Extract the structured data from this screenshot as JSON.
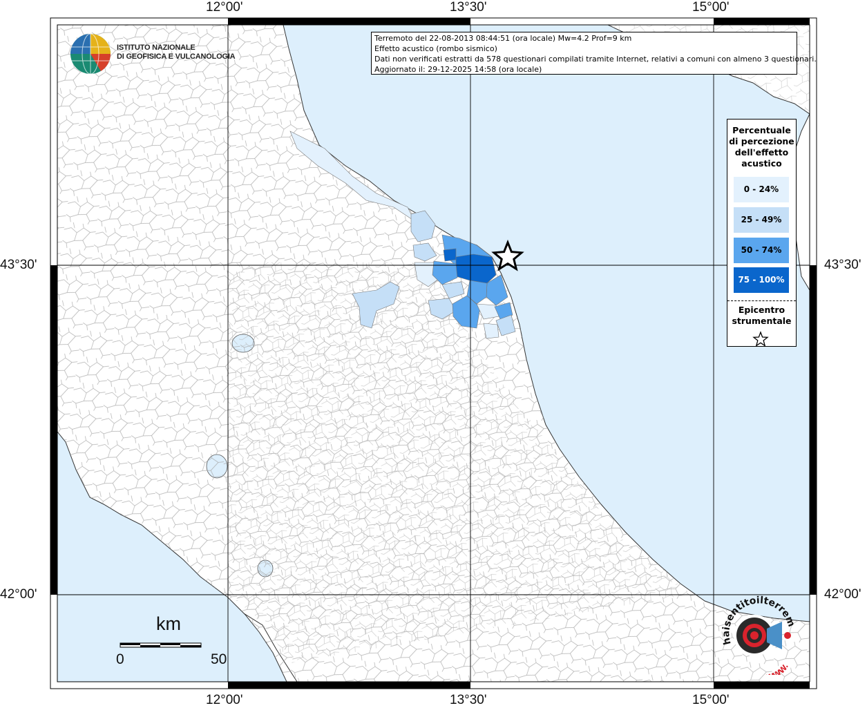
{
  "header": {
    "line1": "Terremoto del 22-08-2013 08:44:51 (ora locale) Mw=4.2 Prof=9 km",
    "line2": "Effetto acustico (rombo sismico)",
    "line3": "Dati non verificati estratti da 578 questionari compilati tramite Internet, relativi a comuni con almeno 3 questionari.",
    "line4": "Aggiornato il: 29-12-2025 14:58 (ora locale)"
  },
  "axes": {
    "top": [
      "12°00'",
      "13°30'",
      "15°00'"
    ],
    "bottom": [
      "12°00'",
      "13°30'",
      "15°00'"
    ],
    "left": [
      "43°30'",
      "42°00'"
    ],
    "right": [
      "43°30'",
      "42°00'"
    ]
  },
  "logo": {
    "line1": "ISTITUTO NAZIONALE",
    "line2": "DI GEOFISICA E VULCANOLOGIA"
  },
  "legend": {
    "title": [
      "Percentuale",
      "di percezione",
      "dell'effetto",
      "acustico"
    ],
    "items": [
      {
        "label": "0 - 24%",
        "color": "#e3f1fd"
      },
      {
        "label": "25 - 49%",
        "color": "#c5dff7"
      },
      {
        "label": "50 - 74%",
        "color": "#5aa6ee"
      },
      {
        "label": "75 - 100%",
        "color": "#0a66cc"
      }
    ],
    "epicentro": [
      "Epicentro",
      "strumentale"
    ]
  },
  "scale": {
    "unit": "km",
    "min": "0",
    "max": "50"
  },
  "colors": {
    "sea": "#ddeffc",
    "land": "#ffffff",
    "border": "#9a9a9a",
    "grid": "#000000"
  },
  "hst_logo": {
    "text": "haisentitoilterremoto.it",
    "url": "WWW."
  }
}
